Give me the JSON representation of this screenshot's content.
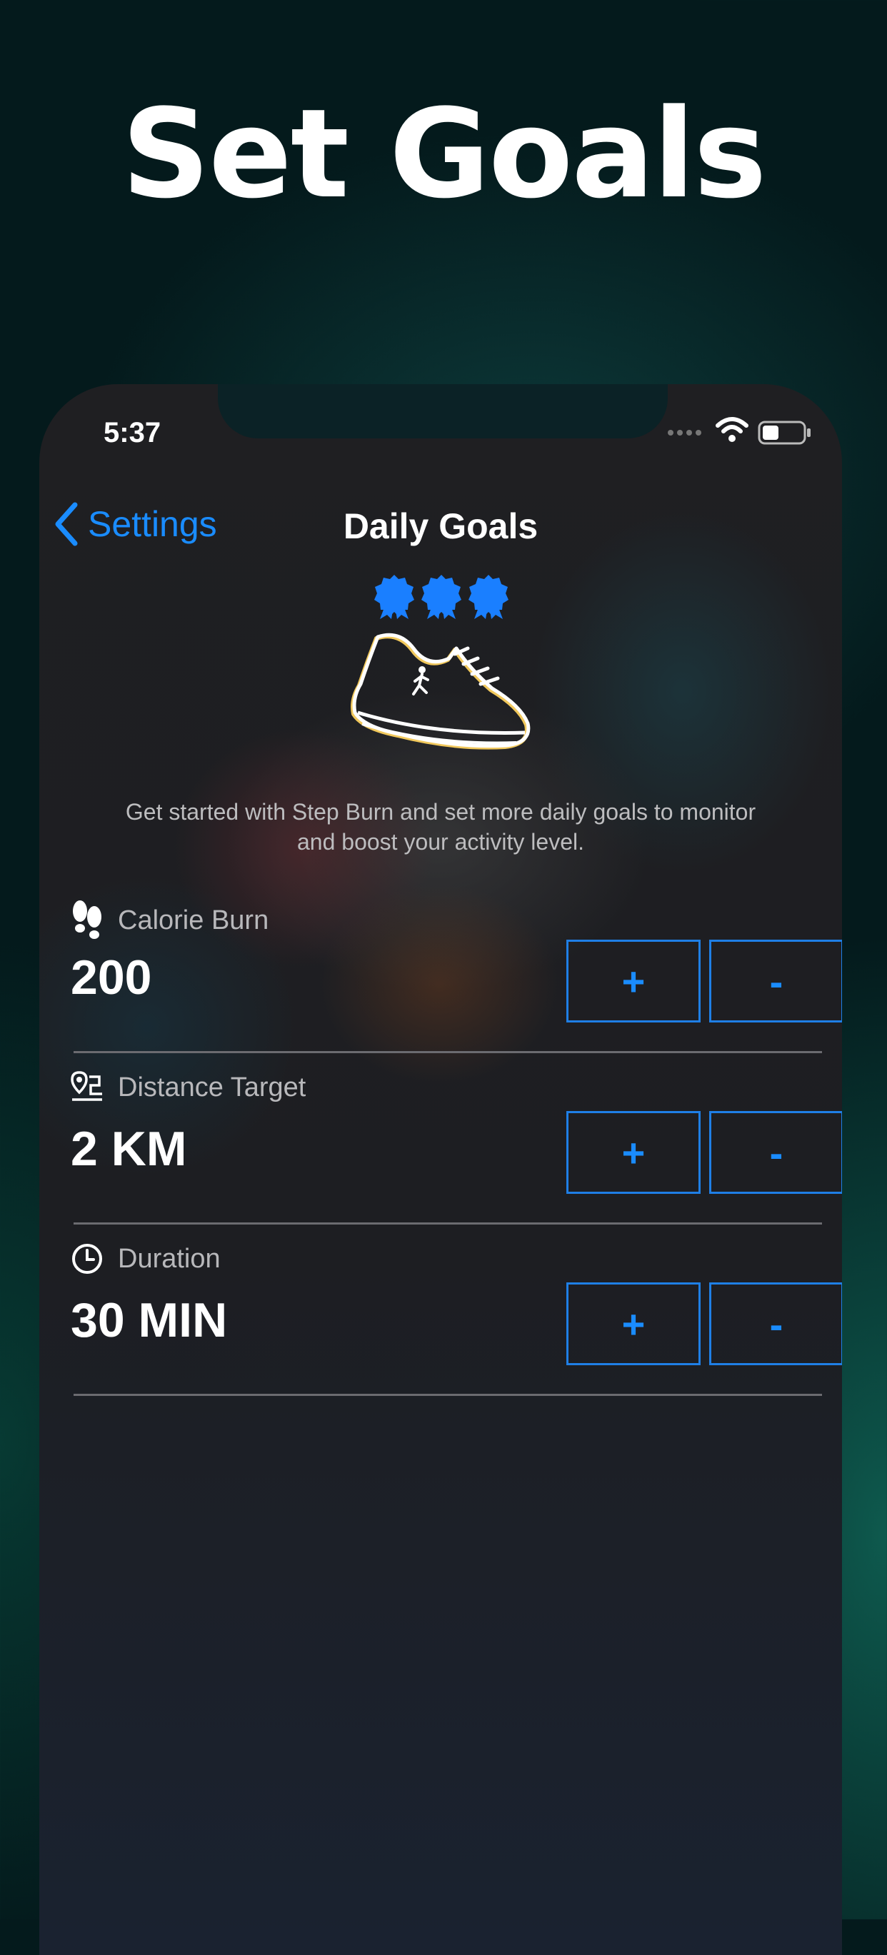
{
  "headline": "Set Goals",
  "status_bar": {
    "time": "5:37"
  },
  "nav": {
    "back_label": "Settings",
    "title": "Daily Goals"
  },
  "intro": "Get started with Step Burn and set more daily goals to monitor and boost your activity level.",
  "accent_color": "#1a8cff",
  "goals": [
    {
      "icon": "footprints-icon",
      "label": "Calorie Burn",
      "value": "200",
      "plus": "+",
      "minus": "-"
    },
    {
      "icon": "route-pin-icon",
      "label": "Distance Target",
      "value": "2 KM",
      "plus": "+",
      "minus": "-"
    },
    {
      "icon": "clock-icon",
      "label": "Duration",
      "value": "30 MIN",
      "plus": "+",
      "minus": "-"
    }
  ]
}
